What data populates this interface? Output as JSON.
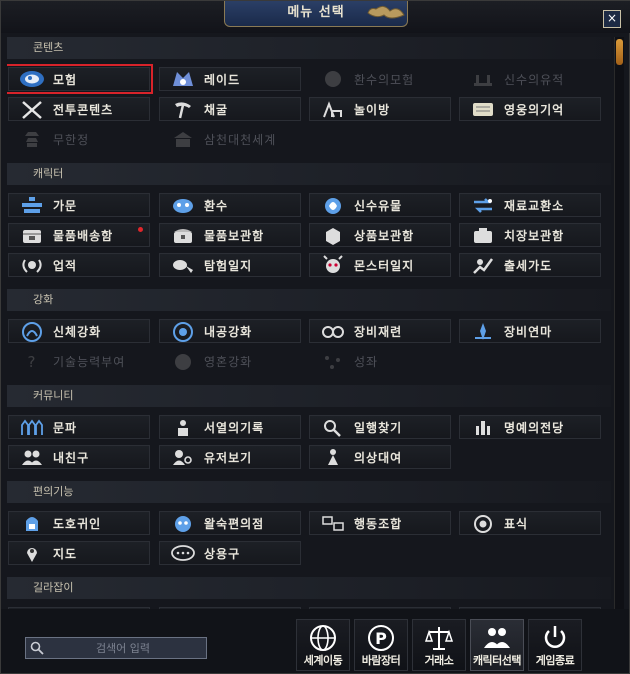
{
  "window": {
    "title": "메뉴 선택",
    "close": "×"
  },
  "sections": [
    {
      "title": "콘텐츠",
      "items": [
        {
          "label": "모험",
          "icon": "adventure-icon",
          "state": "selected"
        },
        {
          "label": "레이드",
          "icon": "raid-icon",
          "state": "enabled"
        },
        {
          "label": "환수의모험",
          "icon": "spirit-adventure-icon",
          "state": "disabled"
        },
        {
          "label": "신수의유적",
          "icon": "divine-ruins-icon",
          "state": "disabled"
        },
        {
          "label": "전투콘텐츠",
          "icon": "crossed-swords-icon",
          "state": "enabled"
        },
        {
          "label": "채굴",
          "icon": "mining-icon",
          "state": "enabled"
        },
        {
          "label": "놀이방",
          "icon": "playroom-icon",
          "state": "enabled"
        },
        {
          "label": "영웅의기억",
          "icon": "scroll-icon",
          "state": "enabled"
        },
        {
          "label": "무한정",
          "icon": "pagoda-icon",
          "state": "disabled"
        },
        {
          "label": "삼천대천세계",
          "icon": "temple-icon",
          "state": "disabled"
        }
      ]
    },
    {
      "title": "캐릭터",
      "items": [
        {
          "label": "가문",
          "icon": "clan-icon",
          "state": "enabled"
        },
        {
          "label": "환수",
          "icon": "spirit-beast-icon",
          "state": "enabled"
        },
        {
          "label": "신수유물",
          "icon": "divine-relic-icon",
          "state": "enabled"
        },
        {
          "label": "재료교환소",
          "icon": "exchange-icon",
          "state": "enabled"
        },
        {
          "label": "물품배송함",
          "icon": "delivery-box-icon",
          "state": "enabled",
          "badge": true
        },
        {
          "label": "물품보관함",
          "icon": "storage-chest-icon",
          "state": "enabled"
        },
        {
          "label": "상품보관함",
          "icon": "product-storage-icon",
          "state": "enabled"
        },
        {
          "label": "치장보관함",
          "icon": "costume-storage-icon",
          "state": "enabled"
        },
        {
          "label": "업적",
          "icon": "achievement-icon",
          "state": "enabled"
        },
        {
          "label": "탐험일지",
          "icon": "exploration-journal-icon",
          "state": "enabled"
        },
        {
          "label": "몬스터일지",
          "icon": "monster-journal-icon",
          "state": "enabled"
        },
        {
          "label": "출세가도",
          "icon": "career-path-icon",
          "state": "enabled"
        }
      ]
    },
    {
      "title": "강화",
      "items": [
        {
          "label": "신체강화",
          "icon": "body-enhance-icon",
          "state": "enabled"
        },
        {
          "label": "내공강화",
          "icon": "inner-power-icon",
          "state": "enabled"
        },
        {
          "label": "장비재련",
          "icon": "equipment-refine-icon",
          "state": "enabled"
        },
        {
          "label": "장비연마",
          "icon": "equipment-polish-icon",
          "state": "enabled"
        },
        {
          "label": "기술능력부여",
          "icon": "skill-grant-icon",
          "state": "disabled"
        },
        {
          "label": "영혼강화",
          "icon": "soul-enhance-icon",
          "state": "disabled"
        },
        {
          "label": "성좌",
          "icon": "constellation-icon",
          "state": "disabled"
        }
      ]
    },
    {
      "title": "커뮤니티",
      "items": [
        {
          "label": "문파",
          "icon": "guild-icon",
          "state": "enabled"
        },
        {
          "label": "서열의기록",
          "icon": "ranking-icon",
          "state": "enabled"
        },
        {
          "label": "일행찾기",
          "icon": "party-search-icon",
          "state": "enabled"
        },
        {
          "label": "명예의전당",
          "icon": "hall-of-fame-icon",
          "state": "enabled"
        },
        {
          "label": "내친구",
          "icon": "friends-icon",
          "state": "enabled"
        },
        {
          "label": "유저보기",
          "icon": "user-view-icon",
          "state": "enabled"
        },
        {
          "label": "의상대여",
          "icon": "costume-rental-icon",
          "state": "enabled"
        }
      ]
    },
    {
      "title": "편의기능",
      "items": [
        {
          "label": "도호귀인",
          "icon": "noble-icon",
          "state": "enabled"
        },
        {
          "label": "왈숙편의점",
          "icon": "convenience-store-icon",
          "state": "enabled"
        },
        {
          "label": "행동조합",
          "icon": "action-combo-icon",
          "state": "enabled"
        },
        {
          "label": "표식",
          "icon": "marker-icon",
          "state": "enabled"
        },
        {
          "label": "지도",
          "icon": "map-pin-icon",
          "state": "enabled"
        },
        {
          "label": "상용구",
          "icon": "chat-bubble-icon",
          "state": "enabled"
        }
      ]
    },
    {
      "title": "길라잡이",
      "items": []
    }
  ],
  "search": {
    "placeholder": "검색어 입력"
  },
  "quick_buttons": [
    {
      "label": "세계이동",
      "icon": "globe-icon"
    },
    {
      "label": "바람장터",
      "icon": "market-icon"
    },
    {
      "label": "거래소",
      "icon": "scales-icon"
    },
    {
      "label": "캐릭터선택",
      "icon": "character-select-icon",
      "active": true
    },
    {
      "label": "게임종료",
      "icon": "power-icon"
    }
  ],
  "colors": {
    "selected_outline": "#d8232a",
    "badge": "#e0262b",
    "title_plate": "#2b3f66",
    "scroll_thumb": "#d99a3a"
  }
}
